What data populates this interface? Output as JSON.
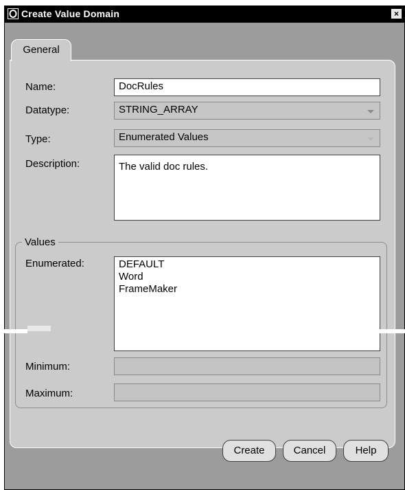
{
  "window": {
    "title": "Create Value Domain",
    "close_label": "×"
  },
  "tabs": [
    {
      "label": "General"
    }
  ],
  "form": {
    "name_label": "Name:",
    "name_value": "DocRules",
    "datatype_label": "Datatype:",
    "datatype_value": "STRING_ARRAY",
    "type_label": "Type:",
    "type_value": "Enumerated Values",
    "description_label": "Description:",
    "description_value": "The valid doc rules."
  },
  "values": {
    "group_label": "Values",
    "enumerated_label": "Enumerated:",
    "enumerated_items": [
      "DEFAULT",
      "Word",
      "FrameMaker"
    ],
    "minimum_label": "Minimum:",
    "minimum_value": "",
    "maximum_label": "Maximum:",
    "maximum_value": ""
  },
  "buttons": {
    "create": "Create",
    "cancel": "Cancel",
    "help": "Help"
  },
  "icons": {
    "app_icon": "oracle-app-icon",
    "close_icon": "close-icon",
    "dropdown_icon": "chevron-down-icon"
  },
  "colors": {
    "titlebar": "#000000",
    "dialog_bg": "#9c9c9c",
    "panel_bg": "#cbcbcb"
  }
}
